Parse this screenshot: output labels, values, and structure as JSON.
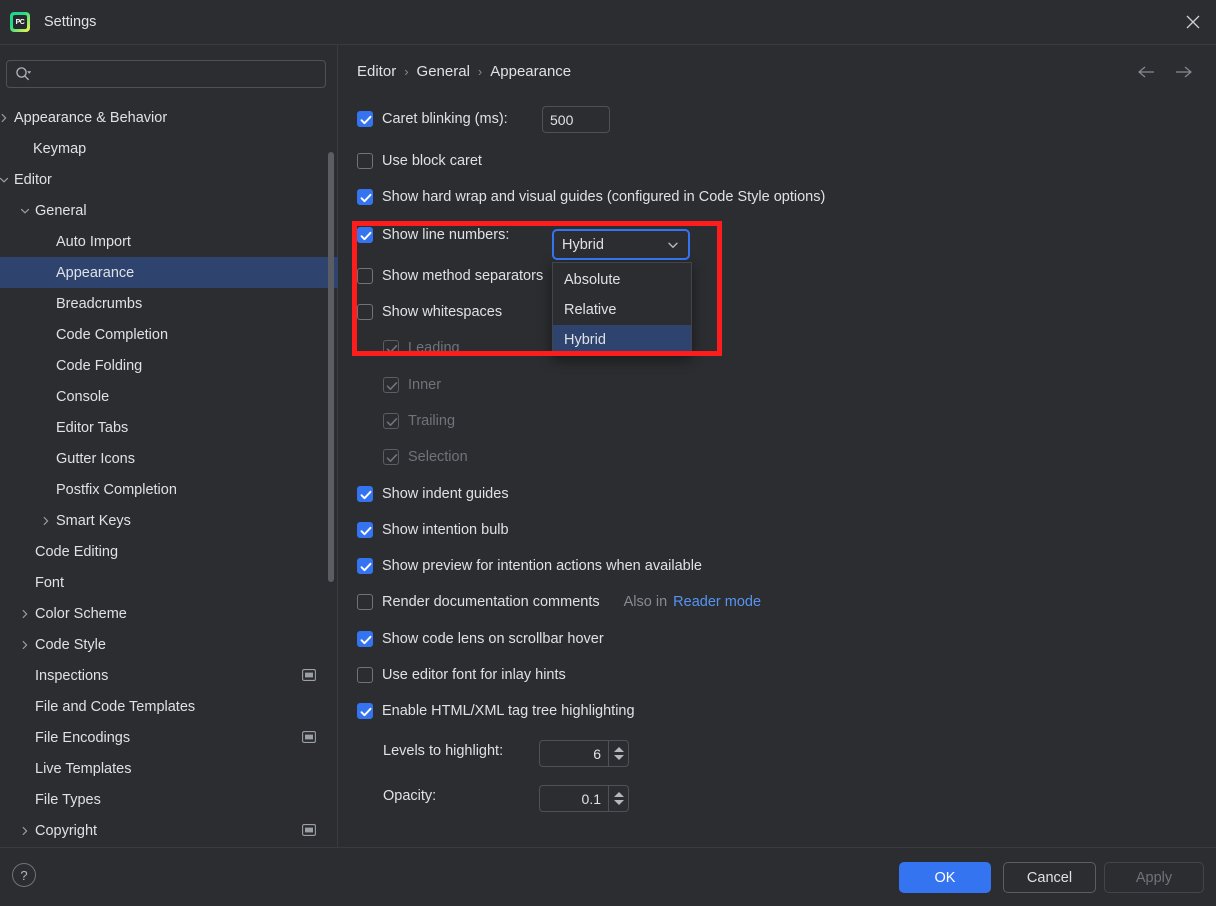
{
  "window": {
    "title": "Settings",
    "app_icon": "pycharm-icon",
    "app_icon_text": "PC",
    "close_icon": "close-icon"
  },
  "sidebar": {
    "search": {
      "placeholder": "",
      "value": "",
      "icon": "search-icon"
    },
    "items": [
      {
        "label": "Appearance & Behavior",
        "indent": 14,
        "arrow": "chevron-right",
        "selected": false,
        "badge": false
      },
      {
        "label": "Keymap",
        "indent": 33,
        "arrow": "",
        "selected": false,
        "badge": false
      },
      {
        "label": "Editor",
        "indent": 14,
        "arrow": "chevron-down",
        "selected": false,
        "badge": false
      },
      {
        "label": "General",
        "indent": 35,
        "arrow": "chevron-down",
        "selected": false,
        "badge": false
      },
      {
        "label": "Auto Import",
        "indent": 56,
        "arrow": "",
        "selected": false,
        "badge": false
      },
      {
        "label": "Appearance",
        "indent": 56,
        "arrow": "",
        "selected": true,
        "badge": false
      },
      {
        "label": "Breadcrumbs",
        "indent": 56,
        "arrow": "",
        "selected": false,
        "badge": false
      },
      {
        "label": "Code Completion",
        "indent": 56,
        "arrow": "",
        "selected": false,
        "badge": false
      },
      {
        "label": "Code Folding",
        "indent": 56,
        "arrow": "",
        "selected": false,
        "badge": false
      },
      {
        "label": "Console",
        "indent": 56,
        "arrow": "",
        "selected": false,
        "badge": false
      },
      {
        "label": "Editor Tabs",
        "indent": 56,
        "arrow": "",
        "selected": false,
        "badge": false
      },
      {
        "label": "Gutter Icons",
        "indent": 56,
        "arrow": "",
        "selected": false,
        "badge": false
      },
      {
        "label": "Postfix Completion",
        "indent": 56,
        "arrow": "",
        "selected": false,
        "badge": false
      },
      {
        "label": "Smart Keys",
        "indent": 56,
        "arrow": "chevron-right",
        "selected": false,
        "badge": false
      },
      {
        "label": "Code Editing",
        "indent": 35,
        "arrow": "",
        "selected": false,
        "badge": false
      },
      {
        "label": "Font",
        "indent": 35,
        "arrow": "",
        "selected": false,
        "badge": false
      },
      {
        "label": "Color Scheme",
        "indent": 35,
        "arrow": "chevron-right",
        "selected": false,
        "badge": false
      },
      {
        "label": "Code Style",
        "indent": 35,
        "arrow": "chevron-right",
        "selected": false,
        "badge": false
      },
      {
        "label": "Inspections",
        "indent": 35,
        "arrow": "",
        "selected": false,
        "badge": true
      },
      {
        "label": "File and Code Templates",
        "indent": 35,
        "arrow": "",
        "selected": false,
        "badge": false
      },
      {
        "label": "File Encodings",
        "indent": 35,
        "arrow": "",
        "selected": false,
        "badge": true
      },
      {
        "label": "Live Templates",
        "indent": 35,
        "arrow": "",
        "selected": false,
        "badge": false
      },
      {
        "label": "File Types",
        "indent": 35,
        "arrow": "",
        "selected": false,
        "badge": false
      },
      {
        "label": "Copyright",
        "indent": 35,
        "arrow": "chevron-right",
        "selected": false,
        "badge": true
      }
    ]
  },
  "header": {
    "breadcrumb": [
      "Editor",
      "General",
      "Appearance"
    ],
    "separator": "›",
    "back_icon": "arrow-left-icon",
    "forward_icon": "arrow-right-icon"
  },
  "settings": {
    "caret_blinking": {
      "label": "Caret blinking (ms):",
      "checked": true,
      "value": "500"
    },
    "use_block_caret": {
      "label": "Use block caret",
      "checked": false
    },
    "show_hard_wrap": {
      "label": "Show hard wrap and visual guides (configured in Code Style options)",
      "checked": true
    },
    "show_line_numbers": {
      "label": "Show line numbers:",
      "checked": true,
      "value": "Hybrid"
    },
    "show_method_separators": {
      "label": "Show method separators",
      "checked": false
    },
    "show_whitespaces": {
      "label": "Show whitespaces",
      "checked": false
    },
    "whitespace_sub": [
      {
        "label": "Leading",
        "checked": true,
        "disabled": true
      },
      {
        "label": "Inner",
        "checked": true,
        "disabled": true
      },
      {
        "label": "Trailing",
        "checked": true,
        "disabled": true
      },
      {
        "label": "Selection",
        "checked": true,
        "disabled": true
      }
    ],
    "show_indent_guides": {
      "label": "Show indent guides",
      "checked": true
    },
    "show_intention_bulb": {
      "label": "Show intention bulb",
      "checked": true
    },
    "show_preview_intention": {
      "label": "Show preview for intention actions when available",
      "checked": true
    },
    "render_doc_comments": {
      "label": "Render documentation comments",
      "checked": false,
      "also_in": "Also in",
      "link": "Reader mode"
    },
    "show_code_lens": {
      "label": "Show code lens on scrollbar hover",
      "checked": true
    },
    "use_editor_font_inlay": {
      "label": "Use editor font for inlay hints",
      "checked": false
    },
    "enable_tag_tree": {
      "label": "Enable HTML/XML tag tree highlighting",
      "checked": true
    },
    "levels_to_highlight": {
      "label": "Levels to highlight:",
      "value": "6"
    },
    "opacity": {
      "label": "Opacity:",
      "value": "0.1"
    }
  },
  "dropdown": {
    "open": true,
    "options": [
      "Absolute",
      "Relative",
      "Hybrid"
    ],
    "selected": "Hybrid",
    "chevron_icon": "chevron-down-icon"
  },
  "footer": {
    "help_label": "?",
    "ok_label": "OK",
    "cancel_label": "Cancel",
    "apply_label": "Apply"
  },
  "colors": {
    "accent": "#3574F0",
    "selection": "#2e436e",
    "highlight_box": "#FF1C1C",
    "link": "#5794F2",
    "background": "#2b2d30",
    "disabled_text": "#6f737a"
  }
}
